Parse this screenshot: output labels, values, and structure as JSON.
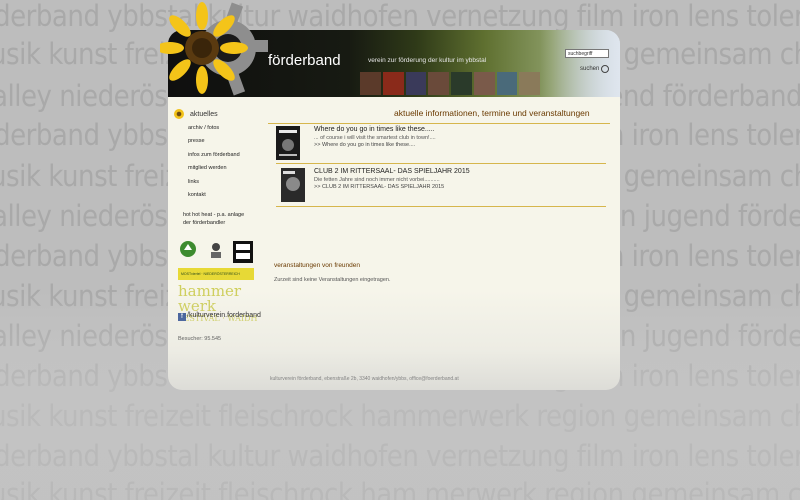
{
  "background_words": [
    "derband ybbstal kultur waidhofen vernetzung film iron lens toleranz",
    "usik kunst freizeit fleischrock hammerwerk region gemeinsam chill vall",
    "alley niederösterreich motiviert spass reggae jugend förderband",
    "derband ybbstal kultur waidhofen vernetzung film iron lens toleranz",
    "usik kunst freizeit fleischrock hammerwerk region gemeinsam chill vall",
    "alley niederösterreich motiviert spass reggae traun jugend förderband",
    "derband ybbstal kultur waidhofen vernetzung film iron lens toleranz",
    "usik kunst freizeit fleischrock hammerwerk region gemeinsam chill vall",
    "alley niederösterreich motiviert spass reggae traun jugend förderband",
    "derband ybbstal kultur waidhofen vernetzung film iron lens toleranz",
    "usik kunst freizeit fleischrock hammerwerk region gemeinsam chill vall",
    "derband ybbstal kultur waidhofen vernetzung film iron lens toleranz",
    "usik kunst freizeit fleischrock ham merwerk region gemeinsam chill val"
  ],
  "header": {
    "site_title": "förderband",
    "tagline": "verein zur förderung der kultur im ybbstal",
    "search_placeholder": "suchbegriff",
    "search_button": "suchen"
  },
  "nav": {
    "items": [
      {
        "label": "aktuelles",
        "active": true
      },
      {
        "label": "archiv / fotos"
      },
      {
        "label": "presse"
      },
      {
        "label": "infos zum förderband"
      },
      {
        "label": "mitglied werden"
      },
      {
        "label": "links"
      },
      {
        "label": "kontakt"
      }
    ],
    "promo_line1": "hot hot heat - p.a. anlage",
    "promo_line2": "der förderbandler",
    "sponsor_badge": "MOSTviertel · NIEDERÖSTERREICH",
    "hammerwerk_line1": "hammer werk",
    "hammerwerk_line2": "FESTIVAL · WAIDH",
    "facebook": "/kulturverein.forderband",
    "visitors": "Besucher: 95.545"
  },
  "main": {
    "heading": "aktuelle informationen, termine und veranstaltungen",
    "posts": [
      {
        "title": "Where do you go in times like these.....",
        "sub": "... of course i will visit the smartest club in town!....",
        "link": ">> Where do you go in times like these...."
      },
      {
        "title": "CLUB 2 IM RITTERSAAL- DAS SPIELJAHR 2015",
        "sub": "Die fetten Jahre sind noch immer nicht vorbei..........",
        "link": ">> CLUB 2 IM RITTERSAAL- DAS SPIELJAHR 2015"
      }
    ],
    "events_heading": "veranstaltungen von freunden",
    "events_text": "Zurzeit sind keine Veranstaltungen eingetragen."
  },
  "footer": {
    "text": "kulturverein förderband, ebenstraße 2b, 3340 waidhofen/ybbs, office@foerderband.at"
  },
  "colors": {
    "background": "#bdbdbd",
    "page": "#f6f5ea",
    "heading": "#6a3a00",
    "accent_line": "#d6b64c"
  }
}
